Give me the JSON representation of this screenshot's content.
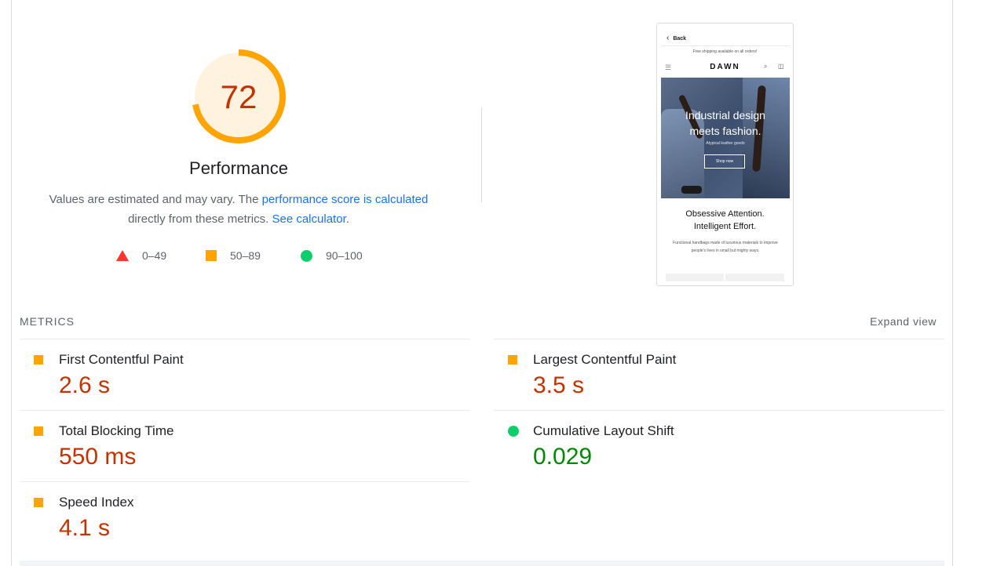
{
  "gauge": {
    "score": "72",
    "score_fraction": 0.72,
    "title": "Performance",
    "ring_color": "#ffa400",
    "fill_color": "#fff3e0",
    "score_color": "#c33300"
  },
  "description": {
    "text1": "Values are estimated and may vary. The ",
    "link1": "performance score is calculated",
    "text2": "directly from these metrics. ",
    "link2": "See calculator",
    "text3": "."
  },
  "legend": [
    {
      "icon": "triangle-icon",
      "color": "#ff3333",
      "label": "0–49"
    },
    {
      "icon": "square-icon",
      "color": "#ffa400",
      "label": "50–89"
    },
    {
      "icon": "circle-icon",
      "color": "#0cce6b",
      "label": "90–100"
    }
  ],
  "screenshot": {
    "back_label": "Back",
    "shipping_banner": "Free shipping available on all orders!",
    "logo": "DAWN",
    "hero_title_line1": "Industrial design",
    "hero_title_line2": "meets fashion.",
    "hero_subtitle": "Atypical leather goods",
    "hero_button": "Shop now",
    "section_title_line1": "Obsessive Attention.",
    "section_title_line2": "Intelligent Effort.",
    "section_text": "Functional handbags made of luxurious materials to improve people's lives in small but mighty ways."
  },
  "metrics": {
    "label": "METRICS",
    "expand_label": "Expand view",
    "items": [
      {
        "title": "First Contentful Paint",
        "value": "2.6 s",
        "status": "average",
        "color": "#c33300"
      },
      {
        "title": "Largest Contentful Paint",
        "value": "3.5 s",
        "status": "average",
        "color": "#c33300"
      },
      {
        "title": "Total Blocking Time",
        "value": "550 ms",
        "status": "average",
        "color": "#c33300"
      },
      {
        "title": "Cumulative Layout Shift",
        "value": "0.029",
        "status": "pass",
        "color": "#008800"
      },
      {
        "title": "Speed Index",
        "value": "4.1 s",
        "status": "average",
        "color": "#c33300"
      }
    ]
  }
}
